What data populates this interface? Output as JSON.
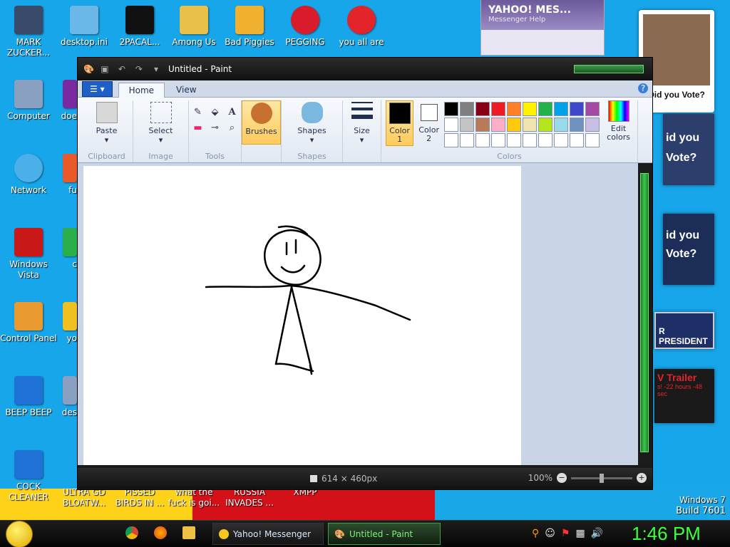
{
  "desktop_icons": [
    {
      "label": "MARK ZUCKER...",
      "color": "#3a4a6b"
    },
    {
      "label": "desktop.ini",
      "color": "#6bb8e8"
    },
    {
      "label": "2PACAL...",
      "color": "#111111"
    },
    {
      "label": "Among Us",
      "color": "#e8c04a"
    },
    {
      "label": "Bad Piggies",
      "color": "#f0b030"
    },
    {
      "label": "PEGGING",
      "color": "#d81c2c"
    },
    {
      "label": "you all are",
      "color": "#e3242b"
    },
    {
      "label": "Computer",
      "color": "#8aa0c0"
    },
    {
      "label": "Network",
      "color": "#4cb0e8"
    },
    {
      "label": "Windows Vista",
      "color": "#c81818"
    },
    {
      "label": "Control Panel",
      "color": "#e89a30"
    },
    {
      "label": "BEEP BEEP",
      "color": "#1e72d6"
    },
    {
      "label": "COCK CLEANER",
      "color": "#1e72d6"
    }
  ],
  "partial_labels": [
    "doe",
    "fu",
    "c",
    "yo",
    "des"
  ],
  "bottom_icons": [
    "ULTRA GD BLOATW...",
    "PISSED BIRDS IN ...",
    "what the fuck is goi...",
    "RUSSIA INVADES ...",
    "XMPP"
  ],
  "yahoo": {
    "title": "YAHOO! MES...",
    "sub": "Messenger   Help"
  },
  "ads": [
    {
      "text": "id you",
      "text2": "Vote?",
      "bg": "#2c3f6c"
    },
    {
      "text": "id you",
      "text2": "Vote?",
      "bg": "#1c2e58"
    },
    {
      "text": "id you",
      "text2": "Vote?",
      "bg": "#2c3f6c"
    },
    {
      "text": "R PRESIDENT",
      "bg": "#1d2f66"
    },
    {
      "text": "V Trailer",
      "text2": "s! -22 hours -48 sec",
      "bg": "#1a1a1a"
    }
  ],
  "ad_top_text": "Did you Vote?",
  "os_label": {
    "line1": "Windows 7",
    "line2": "Build 7601"
  },
  "paint": {
    "title": "Untitled - Paint",
    "tabs": [
      "Home",
      "View"
    ],
    "groups": {
      "clipboard": "Clipboard",
      "image": "Image",
      "tools": "Tools",
      "shapes": "Shapes",
      "colors": "Colors"
    },
    "buttons": {
      "paste": "Paste",
      "select": "Select",
      "brushes": "Brushes",
      "shapes": "Shapes",
      "size": "Size",
      "color1": "Color 1",
      "color2": "Color 2",
      "edit_colors": "Edit colors"
    },
    "palette": [
      "#000000",
      "#7f7f7f",
      "#880015",
      "#ed1c24",
      "#ff7f27",
      "#fff200",
      "#22b14c",
      "#00a2e8",
      "#3f48cc",
      "#a349a4",
      "#ffffff",
      "#c3c3c3",
      "#b97a57",
      "#ffaec9",
      "#ffc90e",
      "#efe4b0",
      "#b5e61d",
      "#99d9ea",
      "#7092be",
      "#c8bfe7",
      "#ffffff",
      "#ffffff",
      "#ffffff",
      "#ffffff",
      "#ffffff",
      "#ffffff",
      "#ffffff",
      "#ffffff",
      "#ffffff",
      "#ffffff"
    ],
    "status": {
      "dimensions": "614 × 460px",
      "zoom": "100%"
    }
  },
  "taskbar": {
    "items": [
      "Yahoo! Messenger",
      "Untitled - Paint"
    ],
    "clock": "1:46 PM"
  }
}
